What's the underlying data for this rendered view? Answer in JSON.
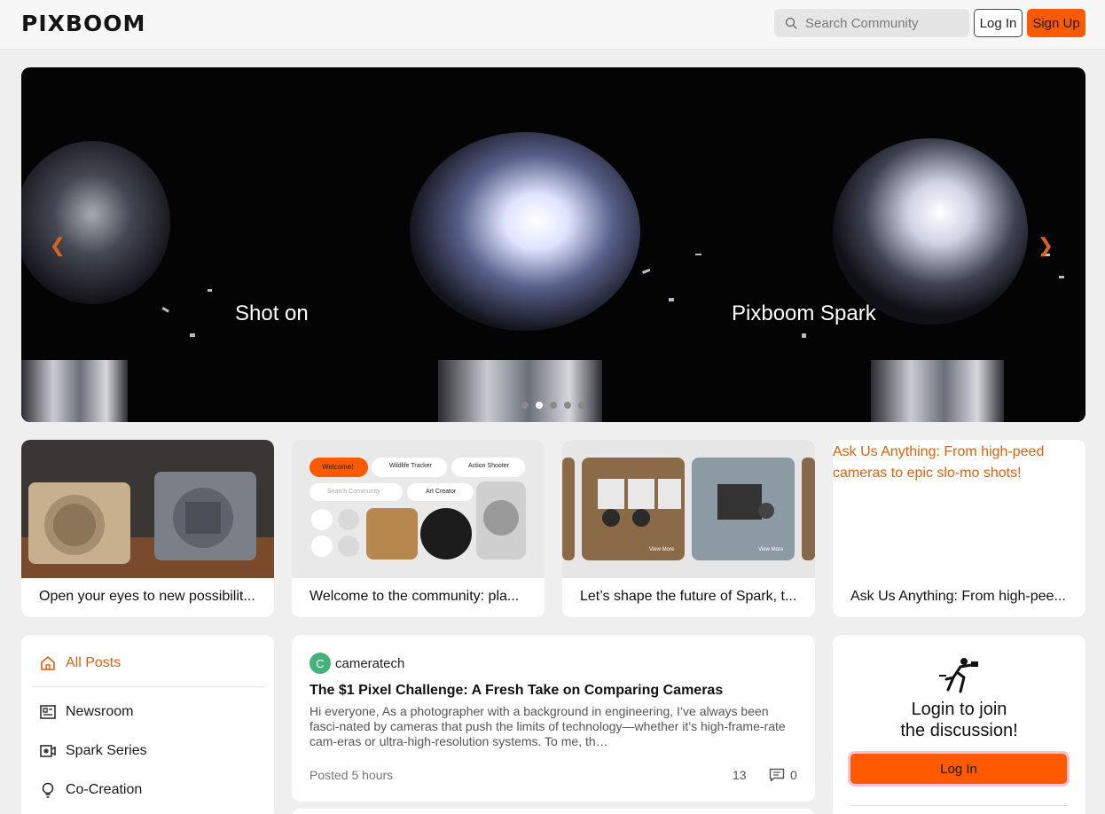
{
  "header": {
    "logo": "PIXBOOM",
    "search_placeholder": "Search Community",
    "login_label": "Log In",
    "signup_label": "Sign Up"
  },
  "hero": {
    "text_left": "Shot on",
    "text_right": "Pixboom Spark",
    "slide_count": 5,
    "active_slide": 2,
    "accent": "#d9621f"
  },
  "cards": [
    {
      "caption": "Open your eyes to new possibilit..."
    },
    {
      "caption": "Welcome to the community: pla...",
      "mock": {
        "chip_welcome": "Welcome!",
        "chip_wildlife": "Wildlife Tracker",
        "chip_action": "Action Shooter",
        "chip_art": "Art Creator",
        "search": "Search Community"
      }
    },
    {
      "caption": "Let’s shape the future of Spark, t...",
      "mock": {
        "view_more": "View More"
      }
    },
    {
      "caption": "Ask Us Anything: From high-pee...",
      "headline": "Ask Us Anything: From high-peed cameras to epic slo-mo shots!"
    }
  ],
  "sidebar": {
    "items": [
      {
        "label": "All Posts",
        "icon": "home-icon",
        "active": true
      },
      {
        "label": "Newsroom",
        "icon": "newspaper-icon"
      },
      {
        "label": "Spark Series",
        "icon": "video-camera-icon"
      },
      {
        "label": "Co-Creation",
        "icon": "lightbulb-icon"
      }
    ]
  },
  "post": {
    "avatar_letter": "C",
    "author": "cameratech",
    "title": "The $1 Pixel Challenge: A Fresh Take on Comparing Cameras",
    "body": "Hi everyone, As a photographer with a background in engineering, I’ve always been fasci-nated by cameras that push the limits of technology—whether it’s high-frame-rate cam-eras or ultra-high-resolution systems. To me, th…",
    "posted": "Posted 5 hours",
    "views": "13",
    "comments": "0"
  },
  "login_card": {
    "title_line1": "Login to join",
    "title_line2": "the discussion!",
    "button": "Log In"
  },
  "colors": {
    "brand_orange": "#ff5a00",
    "active_orange": "#d9620f",
    "avatar_green": "#45b27a"
  }
}
